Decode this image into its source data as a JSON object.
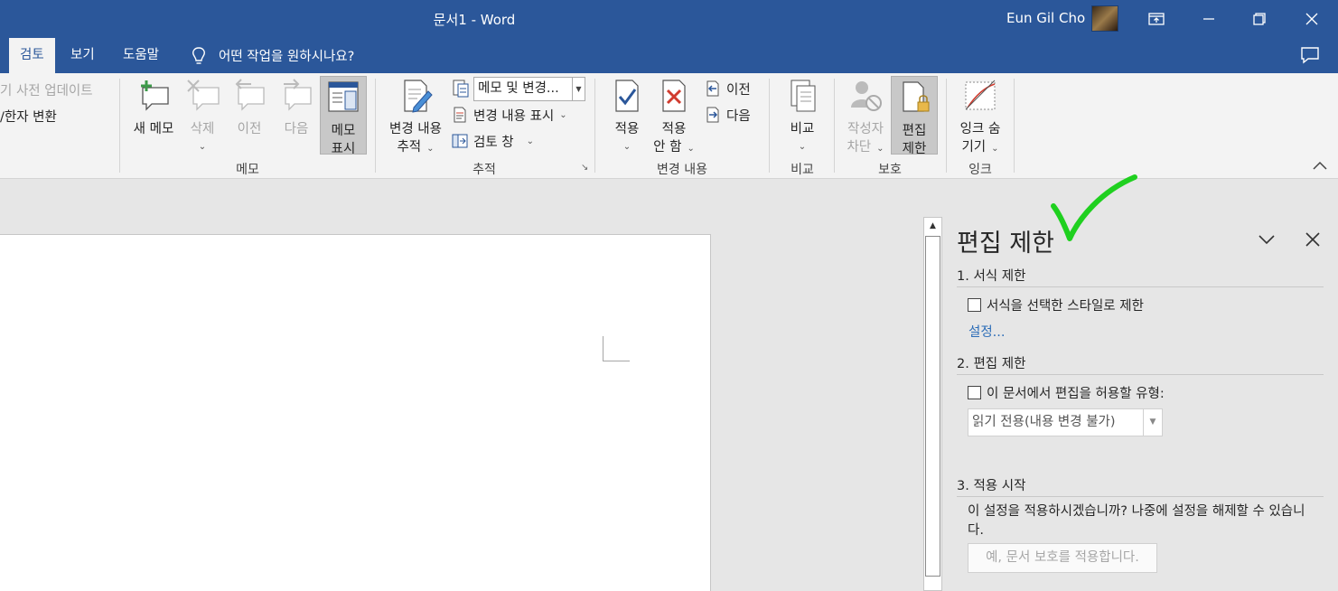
{
  "window": {
    "title": "문서1  -  Word",
    "user": "Eun Gil Cho"
  },
  "tabs": [
    {
      "label": "검토",
      "active": true
    },
    {
      "label": "보기",
      "active": false
    },
    {
      "label": "도움말",
      "active": false
    }
  ],
  "tell_me": "어떤 작업을 원하시나요?",
  "ribbon": {
    "proofing": {
      "thesaurus_update": "기 사전 업데이트",
      "hanja": "/한자 변환"
    },
    "comments": {
      "new": "새 메모",
      "delete": "삭제",
      "previous": "이전",
      "next": "다음",
      "show_line1": "메모",
      "show_line2": "표시",
      "group": "메모"
    },
    "tracking": {
      "track_line1": "변경 내용",
      "track_line2": "추적",
      "markup_combo": "메모 및 변경...",
      "show_markup": "변경 내용 표시",
      "review_pane": "검토 창",
      "group": "추적"
    },
    "changes": {
      "accept": "적용",
      "reject_line1": "적용",
      "reject_line2": "안 함",
      "previous": "이전",
      "next": "다음",
      "group": "변경 내용"
    },
    "compare": {
      "compare": "비교",
      "group": "비교"
    },
    "protect": {
      "block_line1": "작성자",
      "block_line2": "차단",
      "restrict_line1": "편집",
      "restrict_line2": "제한",
      "group": "보호"
    },
    "ink": {
      "hide_line1": "잉크 숨",
      "hide_line2": "기기",
      "group": "잉크"
    }
  },
  "pane": {
    "title": "편집 제한",
    "section1": "1. 서식 제한",
    "format_check": "서식을 선택한 스타일로 제한",
    "format_checked": false,
    "settings_link": "설정...",
    "section2": "2. 편집 제한",
    "edit_check": "이 문서에서 편집을 허용할 유형:",
    "edit_checked": false,
    "edit_select": "읽기 전용(내용 변경 불가)",
    "section3": "3. 적용 시작",
    "apply_note": "이 설정을 적용하시겠습니까? 나중에 설정을 해제할 수 있습니다.",
    "apply_button": "예, 문서 보호를 적용합니다."
  },
  "colors": {
    "titlebar": "#2b579a",
    "ribbon": "#f3f3f3",
    "pane": "#e6e6e6",
    "link": "#2b6cb7",
    "annotation": "#1fd01f"
  }
}
